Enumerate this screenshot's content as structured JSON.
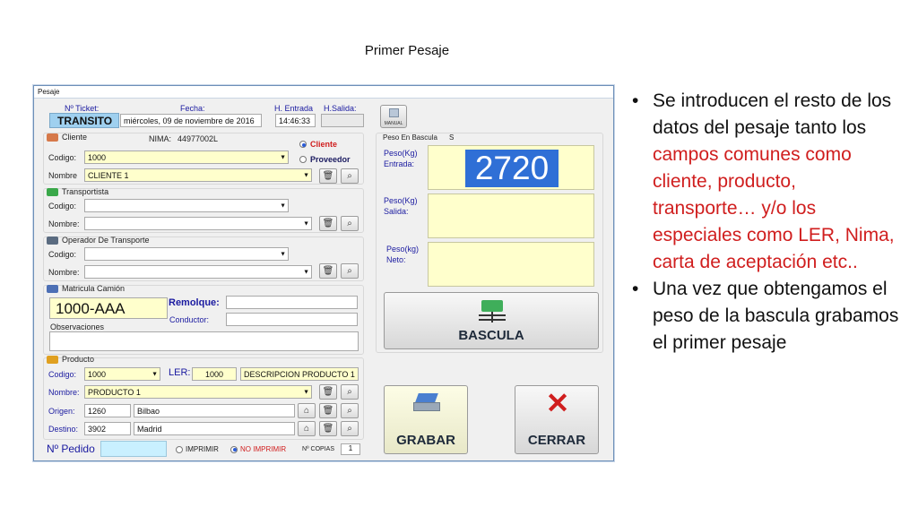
{
  "slide": {
    "title": "Primer Pesaje"
  },
  "window": {
    "title": "Pesaje",
    "ticket_label": "Nº Ticket:",
    "ticket_value": "TRANSITO",
    "fecha_label": "Fecha:",
    "fecha_value": "miércoles, 09 de noviembre de 2016",
    "entrada_label": "H. Entrada",
    "entrada_value": "14:46:33",
    "salida_label": "H.Salida:",
    "salida_value": "",
    "manual_label": "MANUAL",
    "cliente": {
      "section": "Cliente",
      "nima_label": "NIMA:",
      "nima_value": "44977002L",
      "radio_cliente": "Cliente",
      "radio_proveedor": "Proveedor",
      "codigo_label": "Codigo:",
      "codigo_value": "1000",
      "nombre_label": "Nombre",
      "nombre_value": "CLIENTE 1"
    },
    "transportista": {
      "section": "Transportista",
      "codigo_label": "Codigo:",
      "nombre_label": "Nombre:"
    },
    "operador": {
      "section": "Operador De Transporte",
      "codigo_label": "Codigo:",
      "nombre_label": "Nombre:"
    },
    "matricula": {
      "section": "Matricula Camión",
      "value": "1000-AAA",
      "remolque_label": "Remolque:",
      "conductor_label": "Conductor:",
      "observaciones_label": "Observaciones"
    },
    "producto": {
      "section": "Producto",
      "codigo_label": "Codigo:",
      "codigo_value": "1000",
      "ler_label": "LER:",
      "ler_value": "1000",
      "descripcion_value": "DESCRIPCION PRODUCTO 1",
      "nombre_label": "Nombre:",
      "nombre_value": "PRODUCTO 1",
      "origen_label": "Origen:",
      "origen_code": "1260",
      "origen_name": "Bilbao",
      "destino_label": "Destino:",
      "destino_code": "3902",
      "destino_name": "Madrid"
    },
    "pedido": {
      "label": "Nº Pedido",
      "value": "",
      "imprimir": "IMPRIMIR",
      "no_imprimir": "NO IMPRIMIR",
      "copias_label": "Nº COPIAS",
      "copias_value": "1"
    },
    "bascula": {
      "header": "Peso En Bascula",
      "header_flag": "S",
      "entrada_label": "Peso(Kg)\nEntrada:",
      "entrada_value": "2720",
      "salida_label": "Peso(Kg)\nSalida:",
      "neto_label": "Peso(kg)\nNeto:",
      "bascula_button": "BASCULA",
      "grabar_button": "GRABAR",
      "cerrar_button": "CERRAR"
    }
  },
  "bullets": [
    {
      "before": "Se introducen el resto de los datos del pesaje tanto los ",
      "red": "campos comunes como cliente, producto, transporte… y/o los especiales como LER, Nima, carta de aceptación etc..",
      "after": ""
    },
    {
      "before": "Una vez que obtengamos el peso de la bascula grabamos el primer pesaje",
      "red": "",
      "after": ""
    }
  ],
  "colors": {
    "accent_red": "#d01e1e",
    "weight_highlight": "#2f6fd6",
    "field_yellow": "#ffffcc",
    "plate_yellow": "#ffffcc"
  }
}
